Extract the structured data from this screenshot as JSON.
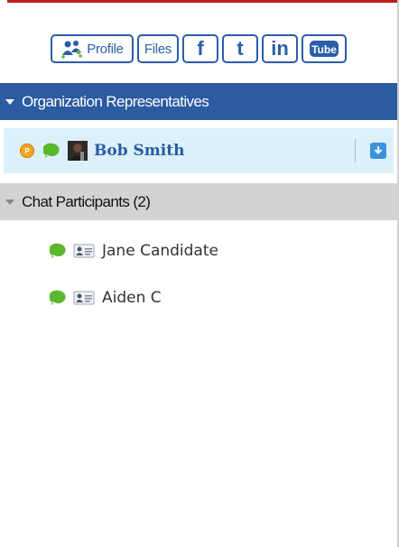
{
  "colors": {
    "accent_red": "#c41a1a",
    "brand_blue": "#2b5ba0",
    "selected_row_bg": "#dcf0fa",
    "section_grey": "#d3d3d3",
    "status_green": "#5cb82e",
    "status_orange": "#f5a623"
  },
  "toolbar": {
    "profile_label": "Profile",
    "files_label": "Files",
    "facebook_glyph": "f",
    "twitter_glyph": "t",
    "linkedin_glyph": "in",
    "youtube_label": "Tube"
  },
  "org_section": {
    "title": "Organization Representatives",
    "representatives": [
      {
        "name": "Bob Smith",
        "badge": "P"
      }
    ]
  },
  "chat_section": {
    "title": "Chat Participants (2)",
    "participants": [
      {
        "name": "Jane Candidate"
      },
      {
        "name": "Aiden C"
      }
    ]
  }
}
